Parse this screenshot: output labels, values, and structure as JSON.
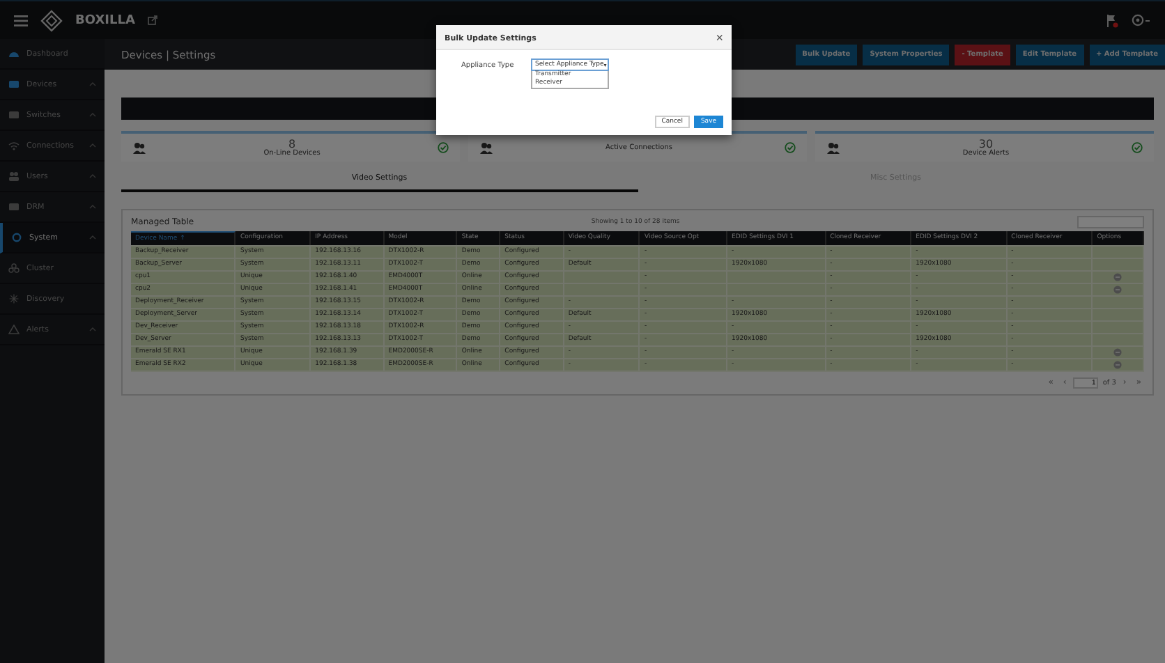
{
  "topbar": {
    "brand": "BOXILLA"
  },
  "sidebar": {
    "items": [
      {
        "label": "Dashboard",
        "selected": false,
        "expandable": false
      },
      {
        "label": "Devices",
        "selected": false,
        "expandable": true
      },
      {
        "label": "Switches",
        "selected": false,
        "expandable": true
      },
      {
        "label": "Connections",
        "selected": false,
        "expandable": true
      },
      {
        "label": "Users",
        "selected": false,
        "expandable": true
      },
      {
        "label": "DRM",
        "selected": false,
        "expandable": true
      },
      {
        "label": "System",
        "selected": true,
        "expandable": true
      },
      {
        "label": "Cluster",
        "selected": false,
        "expandable": false
      },
      {
        "label": "Discovery",
        "selected": false,
        "expandable": false
      },
      {
        "label": "Alerts",
        "selected": false,
        "expandable": true
      }
    ]
  },
  "header": {
    "title": "Devices | Settings",
    "buttons": [
      {
        "label": "Bulk Update",
        "kind": "primary"
      },
      {
        "label": "System Properties",
        "kind": "primary"
      },
      {
        "label": "- Template",
        "kind": "danger"
      },
      {
        "label": "Edit Template",
        "kind": "primary"
      },
      {
        "label": "+ Add Template",
        "kind": "primary"
      }
    ]
  },
  "stats": [
    {
      "value": "8",
      "label": "On-Line Devices"
    },
    {
      "label": "Active Connections"
    },
    {
      "value": "30",
      "label": "Device Alerts"
    }
  ],
  "tabs": [
    {
      "label": "Video Settings",
      "selected": true
    },
    {
      "label": "Misc Settings",
      "selected": false
    }
  ],
  "table": {
    "title": "Managed Table",
    "info": "Showing 1 to 10 of 28 items",
    "columns": [
      {
        "label": "Device Name",
        "sorted": true,
        "sort_arrow": "↑"
      },
      {
        "label": "Configuration",
        "sorted": false
      },
      {
        "label": "IP Address",
        "sorted": false
      },
      {
        "label": "Model",
        "sorted": false
      },
      {
        "label": "State",
        "sorted": false
      },
      {
        "label": "Status",
        "sorted": false
      },
      {
        "label": "Video Quality",
        "sorted": false
      },
      {
        "label": "Video Source Opt",
        "sorted": false
      },
      {
        "label": "EDID Settings DVI 1",
        "sorted": false
      },
      {
        "label": "Cloned Receiver",
        "sorted": false
      },
      {
        "label": "EDID Settings DVI 2",
        "sorted": false
      },
      {
        "label": "Cloned Receiver",
        "sorted": false
      },
      {
        "label": "Options",
        "sorted": false
      }
    ],
    "rows": [
      {
        "cells": [
          "Backup_Receiver",
          "System",
          "192.168.13.16",
          "DTX1002-R",
          "Demo",
          "Configured",
          "-",
          "-",
          "-",
          "-",
          "-",
          "-"
        ],
        "options": false
      },
      {
        "cells": [
          "Backup_Server",
          "System",
          "192.168.13.11",
          "DTX1002-T",
          "Demo",
          "Configured",
          "Default",
          "-",
          "1920x1080",
          "-",
          "1920x1080",
          "-"
        ],
        "options": false
      },
      {
        "cells": [
          "cpu1",
          "Unique",
          "192.168.1.40",
          "EMD4000T",
          "Online",
          "Configured",
          null,
          "-",
          null,
          "-",
          "-",
          "-"
        ],
        "options": true
      },
      {
        "cells": [
          "cpu2",
          "Unique",
          "192.168.1.41",
          "EMD4000T",
          "Online",
          "Configured",
          null,
          "-",
          null,
          "-",
          "-",
          "-"
        ],
        "options": true
      },
      {
        "cells": [
          "Deployment_Receiver",
          "System",
          "192.168.13.15",
          "DTX1002-R",
          "Demo",
          "Configured",
          "-",
          "-",
          "-",
          "-",
          "-",
          "-"
        ],
        "options": false
      },
      {
        "cells": [
          "Deployment_Server",
          "System",
          "192.168.13.14",
          "DTX1002-T",
          "Demo",
          "Configured",
          "Default",
          "-",
          "1920x1080",
          "-",
          "1920x1080",
          "-"
        ],
        "options": false
      },
      {
        "cells": [
          "Dev_Receiver",
          "System",
          "192.168.13.18",
          "DTX1002-R",
          "Demo",
          "Configured",
          "-",
          "-",
          "-",
          "-",
          "-",
          "-"
        ],
        "options": false
      },
      {
        "cells": [
          "Dev_Server",
          "System",
          "192.168.13.13",
          "DTX1002-T",
          "Demo",
          "Configured",
          "Default",
          "-",
          "1920x1080",
          "-",
          "1920x1080",
          "-"
        ],
        "options": false
      },
      {
        "cells": [
          "Emerald SE RX1",
          "Unique",
          "192.168.1.39",
          "EMD2000SE-R",
          "Online",
          "Configured",
          "-",
          "-",
          "-",
          "-",
          "-",
          "-"
        ],
        "options": true
      },
      {
        "cells": [
          "Emerald SE RX2",
          "Unique",
          "192.168.1.38",
          "EMD2000SE-R",
          "Online",
          "Configured",
          "-",
          "-",
          "-",
          "-",
          "-",
          "-"
        ],
        "options": true
      }
    ],
    "pagination": {
      "first": "«",
      "prev": "‹",
      "page": "1",
      "of": "of 3",
      "next": "›",
      "last": "»"
    }
  },
  "modal": {
    "title": "Bulk Update Settings",
    "close": "×",
    "field_label": "Appliance Type",
    "select_value": "Select Appliance Type",
    "select_caret": "▾",
    "options": [
      {
        "label": "Transmitter",
        "selected": false
      },
      {
        "label": "Receiver",
        "selected": false
      }
    ],
    "buttons": [
      {
        "label": "Cancel",
        "kind": "default"
      },
      {
        "label": "Save",
        "kind": "primary"
      }
    ]
  }
}
